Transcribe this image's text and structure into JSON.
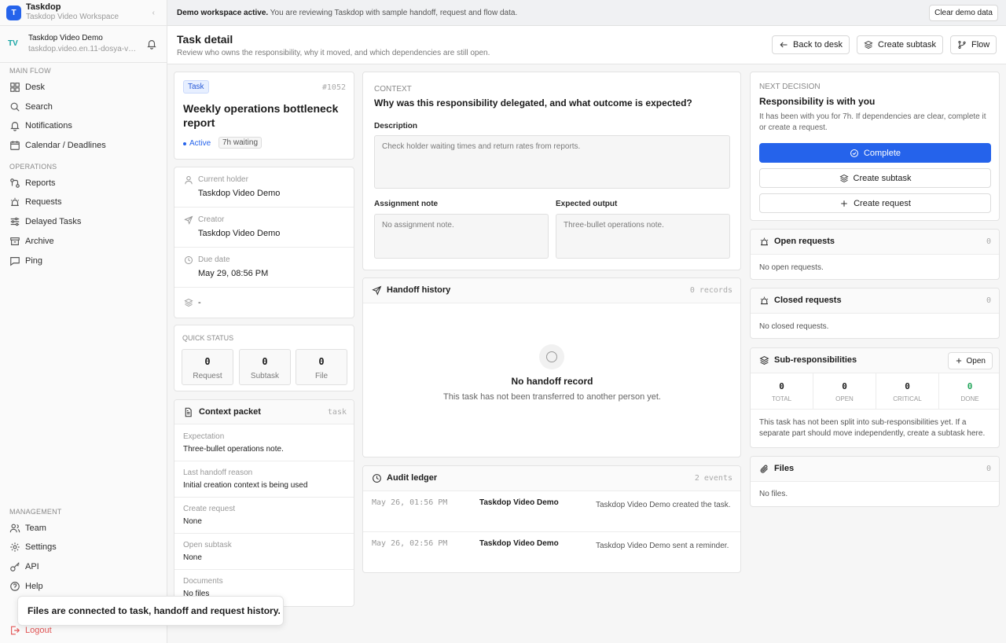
{
  "workspace": {
    "logo": "T",
    "name": "Taskdop",
    "subtitle": "Taskdop Video Workspace",
    "collapse": "‹"
  },
  "user": {
    "avatar": "TV",
    "name": "Taskdop Video Demo",
    "email": "taskdop.video.en.11-dosya-ve..."
  },
  "nav": {
    "main_flow_title": "MAIN FLOW",
    "main_flow": [
      {
        "label": "Desk",
        "icon": "grid-icon"
      },
      {
        "label": "Search",
        "icon": "search-icon"
      },
      {
        "label": "Notifications",
        "icon": "bell-icon"
      },
      {
        "label": "Calendar / Deadlines",
        "icon": "calendar-icon"
      }
    ],
    "operations_title": "OPERATIONS",
    "operations": [
      {
        "label": "Reports",
        "icon": "reports-icon"
      },
      {
        "label": "Requests",
        "icon": "siren-icon"
      },
      {
        "label": "Delayed Tasks",
        "icon": "sliders-icon"
      },
      {
        "label": "Archive",
        "icon": "archive-icon"
      },
      {
        "label": "Ping",
        "icon": "message-icon"
      }
    ],
    "management_title": "MANAGEMENT",
    "management": [
      {
        "label": "Team",
        "icon": "users-icon"
      },
      {
        "label": "Settings",
        "icon": "gear-icon"
      },
      {
        "label": "API",
        "icon": "key-icon"
      },
      {
        "label": "Help",
        "icon": "help-icon"
      }
    ],
    "logout": "Logout"
  },
  "banner": {
    "strong": "Demo workspace active.",
    "text": " You are reviewing Taskdop with sample handoff, request and flow data.",
    "clear_label": "Clear demo data"
  },
  "header": {
    "title": "Task detail",
    "subtitle": "Review who owns the responsibility, why it moved, and which dependencies are still open.",
    "back_label": "Back to desk",
    "subtask_label": "Create subtask",
    "flow_label": "Flow"
  },
  "task": {
    "badge": "Task",
    "id": "#1052",
    "title": "Weekly operations bottleneck report",
    "status": "Active",
    "waiting": "7h waiting"
  },
  "meta": [
    {
      "label": "Current holder",
      "value": "Taskdop Video Demo"
    },
    {
      "label": "Creator",
      "value": "Taskdop Video Demo"
    },
    {
      "label": "Due date",
      "value": "May 29, 08:56 PM"
    },
    {
      "label": "",
      "value": "-"
    }
  ],
  "quick_status": {
    "title": "QUICK STATUS",
    "items": [
      {
        "value": "0",
        "label": "Request"
      },
      {
        "value": "0",
        "label": "Subtask"
      },
      {
        "value": "0",
        "label": "File"
      }
    ]
  },
  "context_packet": {
    "title": "Context packet",
    "tag": "task",
    "rows": [
      {
        "label": "Expectation",
        "value": "Three-bullet operations note."
      },
      {
        "label": "Last handoff reason",
        "value": "Initial creation context is being used"
      },
      {
        "label": "Create request",
        "value": "None"
      },
      {
        "label": "Open subtask",
        "value": "None"
      },
      {
        "label": "Documents",
        "value": "No files"
      }
    ]
  },
  "context": {
    "label": "CONTEXT",
    "question": "Why was this responsibility delegated, and what outcome is expected?",
    "description_label": "Description",
    "description_value": "Check holder waiting times and return rates from reports.",
    "assignment_label": "Assignment note",
    "assignment_value": "No assignment note.",
    "output_label": "Expected output",
    "output_value": "Three-bullet operations note."
  },
  "handoff": {
    "title": "Handoff history",
    "count": "0 records",
    "empty_title": "No handoff record",
    "empty_text": "This task has not been transferred to another person yet."
  },
  "audit": {
    "title": "Audit ledger",
    "count": "2 events",
    "events": [
      {
        "time": "May 26, 01:56 PM",
        "who": "Taskdop Video Demo",
        "what": "Taskdop Video Demo created the task."
      },
      {
        "time": "May 26, 02:56 PM",
        "who": "Taskdop Video Demo",
        "what": "Taskdop Video Demo sent a reminder."
      }
    ]
  },
  "decision": {
    "label": "NEXT DECISION",
    "title": "Responsibility is with you",
    "text": "It has been with you for 7h. If dependencies are clear, complete it or create a request.",
    "complete_label": "Complete",
    "subtask_label": "Create subtask",
    "request_label": "Create request"
  },
  "open_requests": {
    "title": "Open requests",
    "count": "0",
    "empty": "No open requests."
  },
  "closed_requests": {
    "title": "Closed requests",
    "count": "0",
    "empty": "No closed requests."
  },
  "subs": {
    "title": "Sub-responsibilities",
    "open_label": "Open",
    "stats": [
      {
        "value": "0",
        "label": "TOTAL"
      },
      {
        "value": "0",
        "label": "OPEN"
      },
      {
        "value": "0",
        "label": "CRITICAL"
      },
      {
        "value": "0",
        "label": "DONE"
      }
    ],
    "text": "This task has not been split into sub-responsibilities yet. If a separate part should move independently, create a subtask here."
  },
  "files": {
    "title": "Files",
    "count": "0",
    "empty": "No files."
  },
  "toast": {
    "text": "Files are connected to task, handoff and request history."
  },
  "colors": {
    "accent": "#2563eb",
    "done": "#22a55a",
    "danger": "#e25555"
  }
}
